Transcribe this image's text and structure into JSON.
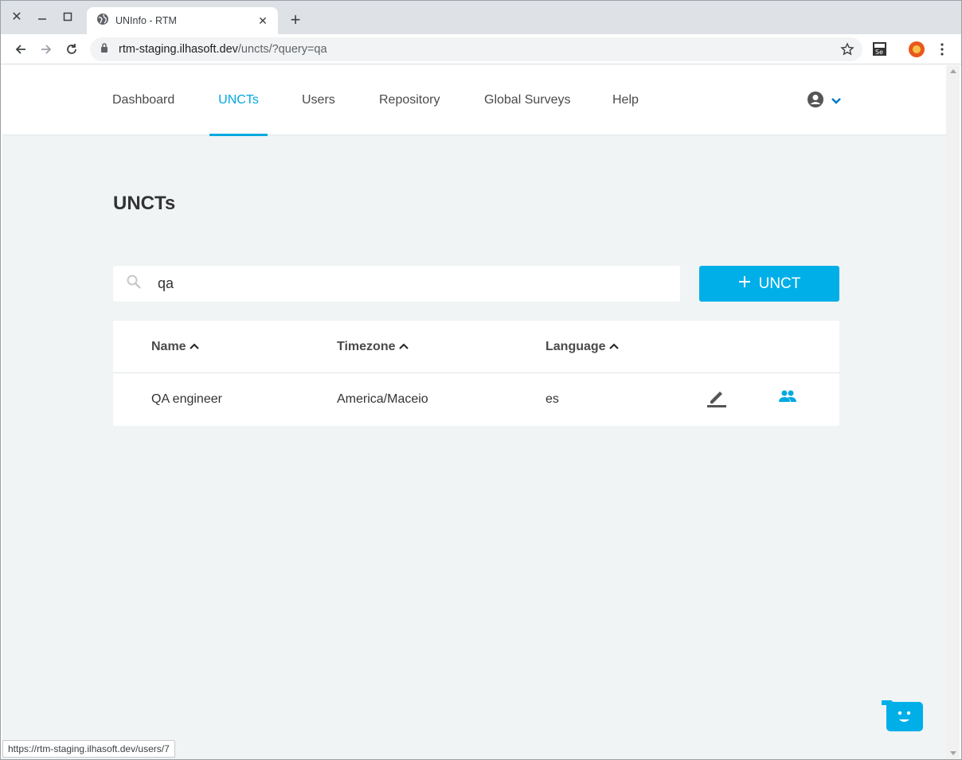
{
  "browser": {
    "tab_title": "UNInfo - RTM",
    "url_host": "rtm-staging.ilhasoft.dev",
    "url_path": "/uncts/?query=qa",
    "status_url": "https://rtm-staging.ilhasoft.dev/users/7"
  },
  "nav": {
    "items": [
      {
        "label": "Dashboard",
        "active": false
      },
      {
        "label": "UNCTs",
        "active": true
      },
      {
        "label": "Users",
        "active": false
      },
      {
        "label": "Repository",
        "active": false
      },
      {
        "label": "Global Surveys",
        "active": false
      },
      {
        "label": "Help",
        "active": false
      }
    ]
  },
  "page": {
    "title": "UNCTs",
    "search_value": "qa",
    "add_button": "UNCT"
  },
  "table": {
    "columns": [
      "Name",
      "Timezone",
      "Language"
    ],
    "rows": [
      {
        "name": "QA engineer",
        "timezone": "America/Maceio",
        "language": "es"
      }
    ]
  },
  "colors": {
    "accent": "#00a9e0",
    "button": "#00afe8",
    "background": "#f0f4f5"
  }
}
